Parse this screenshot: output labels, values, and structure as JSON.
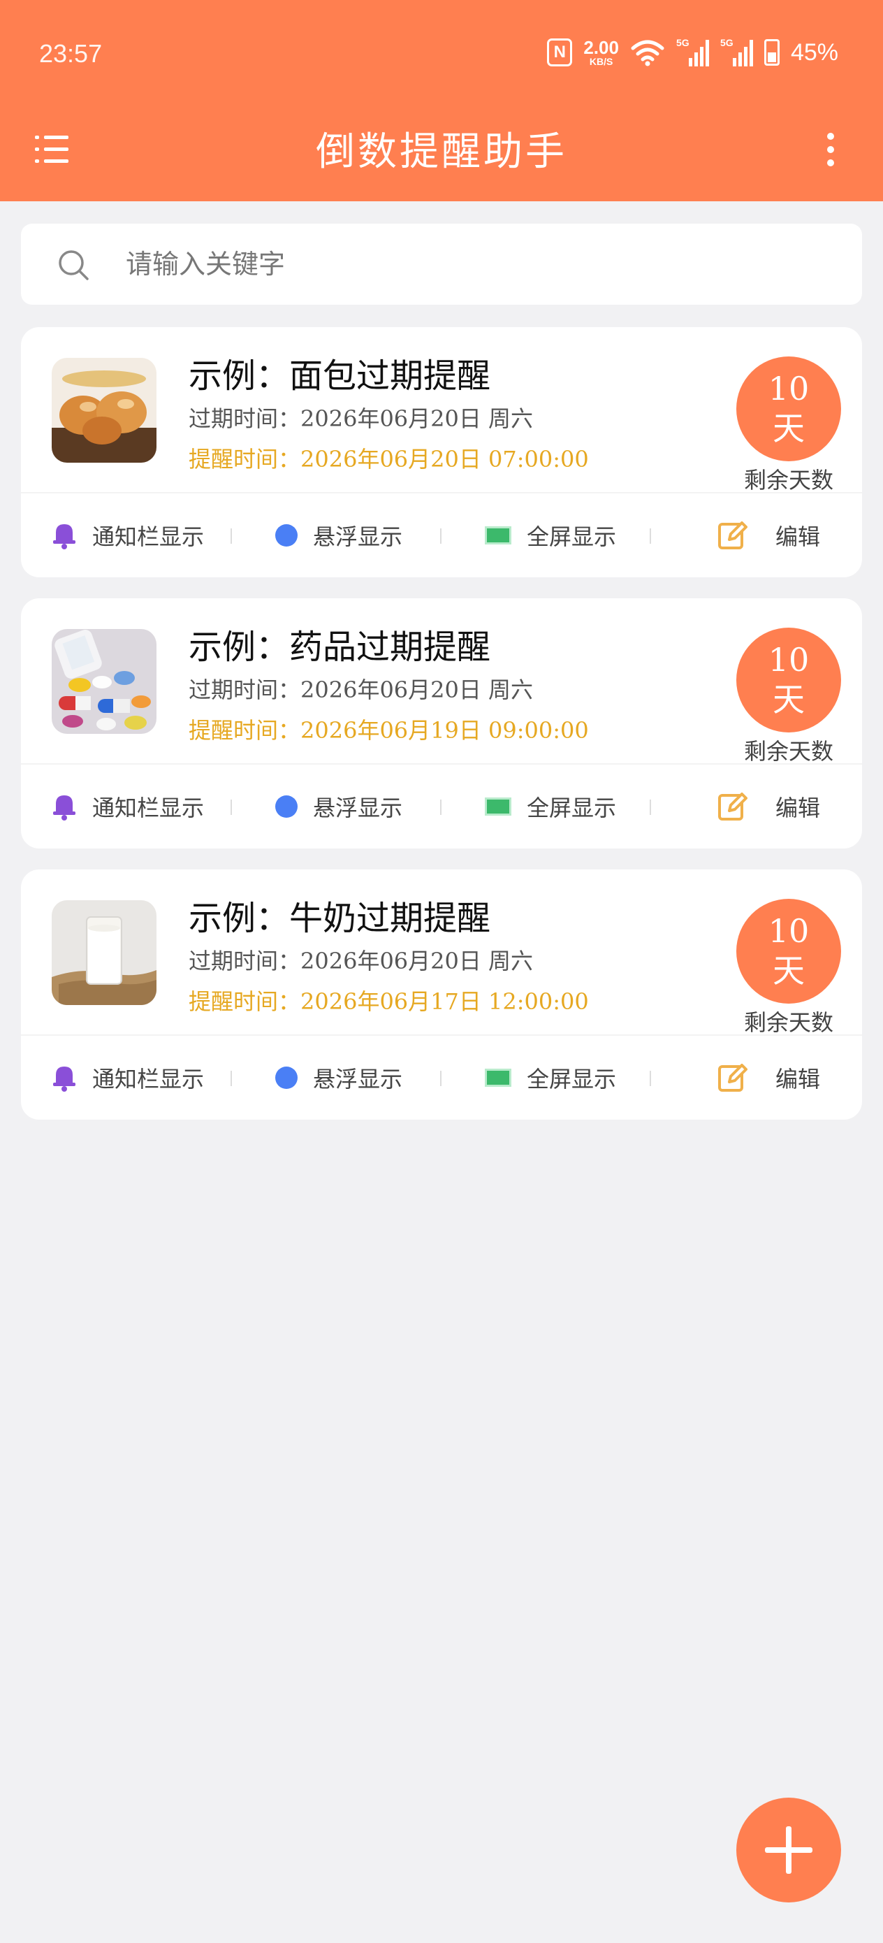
{
  "status_bar": {
    "time": "23:57",
    "nfc": "N",
    "net_speed": "2.00",
    "net_unit": "KB/S",
    "sim1": "5G",
    "sim2": "5G",
    "battery": "45%"
  },
  "app_bar": {
    "title": "倒数提醒助手",
    "menu_icon": "menu-list-icon",
    "more_icon": "more-vertical-icon"
  },
  "search": {
    "placeholder": "请输入关键字",
    "icon": "search-icon"
  },
  "colors": {
    "accent": "#ff7f50",
    "remind_text": "#e6a822",
    "bell": "#8a4fd8",
    "float_dot": "#4a7ff5",
    "fullscreen": "#3cb96b",
    "edit": "#f0b04a"
  },
  "cards": [
    {
      "title": "示例：面包过期提醒",
      "expire": "过期时间：2026年06月20日    周六",
      "remind": "提醒时间：2026年06月20日 07:00:00",
      "days_value": "10",
      "days_unit": "天",
      "days_label": "剩余天数",
      "thumb": "bread",
      "actions": {
        "notify": "通知栏显示",
        "float": "悬浮显示",
        "fullscreen": "全屏显示",
        "edit": "编辑"
      }
    },
    {
      "title": "示例：药品过期提醒",
      "expire": "过期时间：2026年06月20日    周六",
      "remind": "提醒时间：2026年06月19日 09:00:00",
      "days_value": "10",
      "days_unit": "天",
      "days_label": "剩余天数",
      "thumb": "medicine",
      "actions": {
        "notify": "通知栏显示",
        "float": "悬浮显示",
        "fullscreen": "全屏显示",
        "edit": "编辑"
      }
    },
    {
      "title": "示例：牛奶过期提醒",
      "expire": "过期时间：2026年06月20日    周六",
      "remind": "提醒时间：2026年06月17日 12:00:00",
      "days_value": "10",
      "days_unit": "天",
      "days_label": "剩余天数",
      "thumb": "milk",
      "actions": {
        "notify": "通知栏显示",
        "float": "悬浮显示",
        "fullscreen": "全屏显示",
        "edit": "编辑"
      }
    }
  ],
  "fab": {
    "icon": "plus-icon"
  }
}
